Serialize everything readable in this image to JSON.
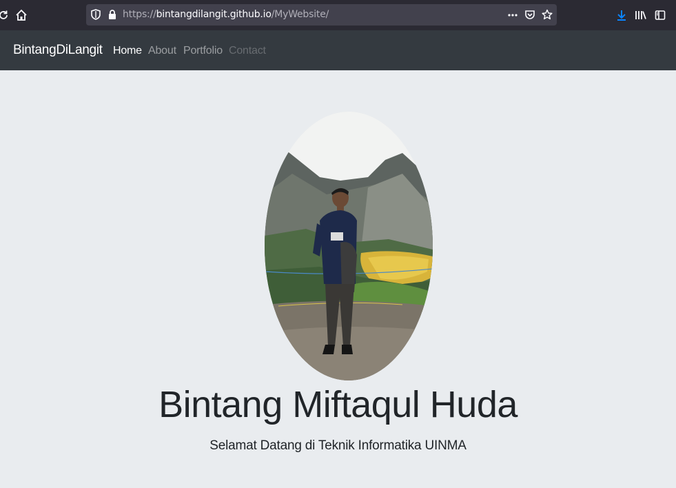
{
  "browser": {
    "url_scheme": "https://",
    "url_host": "bintangdilangit.github.io",
    "url_path": "/MyWebsite/",
    "icons": {
      "reload": "reload-icon",
      "home": "home-icon",
      "shield": "tracking-shield-icon",
      "lock": "lock-icon",
      "more": "more-icon",
      "pocket": "pocket-icon",
      "bookmark": "star-icon",
      "download": "download-icon",
      "library": "library-icon",
      "sidebar": "sidebar-icon"
    },
    "accent_color": "#0a84ff"
  },
  "navbar": {
    "brand": "BintangDiLangit",
    "links": [
      {
        "label": "Home",
        "state": "active"
      },
      {
        "label": "About",
        "state": "normal"
      },
      {
        "label": "Portfolio",
        "state": "normal"
      },
      {
        "label": "Contact",
        "state": "disabled"
      }
    ],
    "background": "#343a40"
  },
  "hero": {
    "title": "Bintang Miftaqul Huda",
    "subtitle": "Selamat Datang di Teknik Informatika UINMA",
    "background": "#e9ecef"
  }
}
